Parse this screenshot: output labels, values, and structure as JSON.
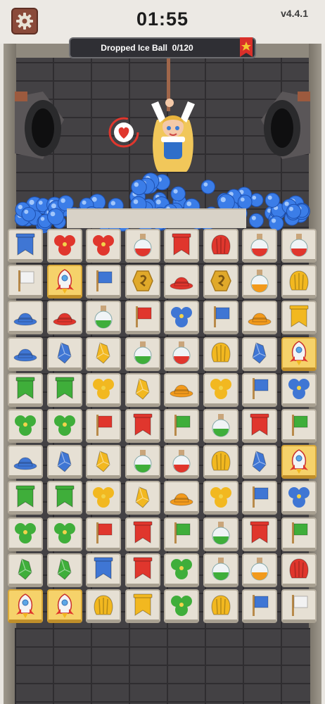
{
  "header": {
    "timer": "01:55",
    "version": "v4.4.1",
    "settings_icon": "gear-icon"
  },
  "progress": {
    "label": "Dropped Ice Ball",
    "count": "0/120",
    "badge_icon": "star-banner-icon"
  },
  "scene": {
    "heart_icon": "heart-icon",
    "character": "girl-hanging-on-rope",
    "balls_icon": "ice-ball-icon"
  },
  "board": {
    "rows": 11,
    "cols": 8,
    "grid": [
      [
        "blue-banner",
        "red-flower",
        "red-flower",
        "red-potion",
        "red-banner",
        "red-shell",
        "red-potion",
        "red-potion"
      ],
      [
        "white-flag",
        "rocket",
        "blue-flag",
        "gold-coin",
        "red-hat",
        "gold-coin",
        "orange-potion",
        "yellow-shell"
      ],
      [
        "blue-hat",
        "red-hat",
        "green-potion",
        "red-flag",
        "blue-flower",
        "blue-flag",
        "orange-hat",
        "yellow-banner"
      ],
      [
        "blue-hat",
        "blue-crystal",
        "yellow-crystal",
        "green-potion",
        "red-potion",
        "yellow-shell",
        "blue-crystal",
        "rocket"
      ],
      [
        "green-banner",
        "green-banner",
        "yellow-flower",
        "yellow-crystal",
        "orange-hat",
        "yellow-flower",
        "blue-flag",
        "blue-flower"
      ],
      [
        "green-flower",
        "green-flower",
        "red-flag",
        "red-banner",
        "green-flag",
        "green-potion",
        "red-banner",
        "green-flag"
      ],
      [
        "blue-hat",
        "blue-crystal",
        "yellow-crystal",
        "green-potion",
        "red-potion",
        "yellow-shell",
        "blue-crystal",
        "rocket"
      ],
      [
        "green-banner",
        "green-banner",
        "yellow-flower",
        "yellow-crystal",
        "orange-hat",
        "yellow-flower",
        "blue-flag",
        "blue-flower"
      ],
      [
        "green-flower",
        "green-flower",
        "red-flag",
        "red-banner",
        "green-flag",
        "green-potion",
        "red-banner",
        "green-flag"
      ],
      [
        "green-crystal",
        "green-crystal",
        "blue-banner",
        "red-banner",
        "green-flower",
        "green-potion",
        "orange-potion",
        "red-shell"
      ],
      [
        "rocket",
        "rocket",
        "yellow-shell",
        "yellow-banner",
        "green-flower",
        "yellow-shell",
        "blue-flag",
        "white-flag"
      ]
    ]
  },
  "colors": {
    "blue": "#3f76d4",
    "red": "#e0362d",
    "green": "#3fae3a",
    "yellow": "#f2b820",
    "orange": "#f29a1c",
    "white": "#f2f2f2",
    "tile_bg": "#e6e0d4",
    "tile_highlight": "#f6d26a",
    "ice": "#3b7de8"
  }
}
